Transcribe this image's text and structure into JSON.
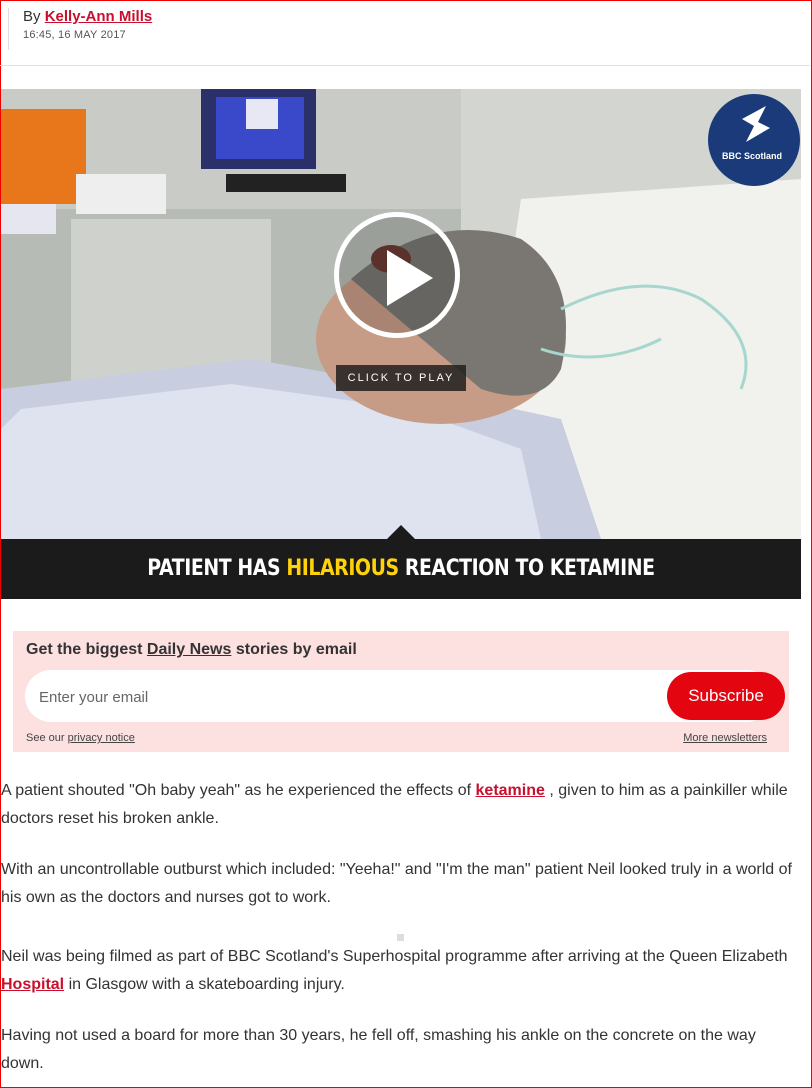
{
  "byline": {
    "prefix": "By",
    "author": "Kelly-Ann Mills",
    "timestamp": "16:45, 16 MAY 2017"
  },
  "video": {
    "play_label": "CLICK TO PLAY",
    "logo_text": "BBC Scotland",
    "caption_before": "PATIENT HAS ",
    "caption_highlight": "HILARIOUS",
    "caption_after": " REACTION TO KETAMINE",
    "highlight_color": "#ffd20a"
  },
  "newsletter": {
    "title_before": "Get the biggest ",
    "title_link": "Daily News",
    "title_after": " stories by email",
    "email_placeholder": "Enter your email",
    "subscribe_label": "Subscribe",
    "privacy_prefix": "See our",
    "privacy_link": "privacy notice",
    "more_link": "More newsletters",
    "accent_color": "#e3050f"
  },
  "article": {
    "p1_before": "A patient shouted \"Oh baby yeah\" as he experienced the effects of",
    "p1_link": "ketamine",
    "p1_after": ", given to him as a painkiller while doctors reset his broken ankle.",
    "p2": "With an uncontrollable outburst which included: \"Yeeha!\" and \"I'm the man\" patient Neil looked truly in a world of his own as the doctors and nurses got to work.",
    "p3_before": "Neil was being filmed as part of BBC Scotland's Superhospital programme after arriving at the Queen Elizabeth",
    "p3_link": "Hospital",
    "p3_after": "in Glasgow with a skateboarding injury.",
    "p4": "Having not used a board for more than 30 years, he fell off, smashing his ankle on the concrete on the way down."
  }
}
